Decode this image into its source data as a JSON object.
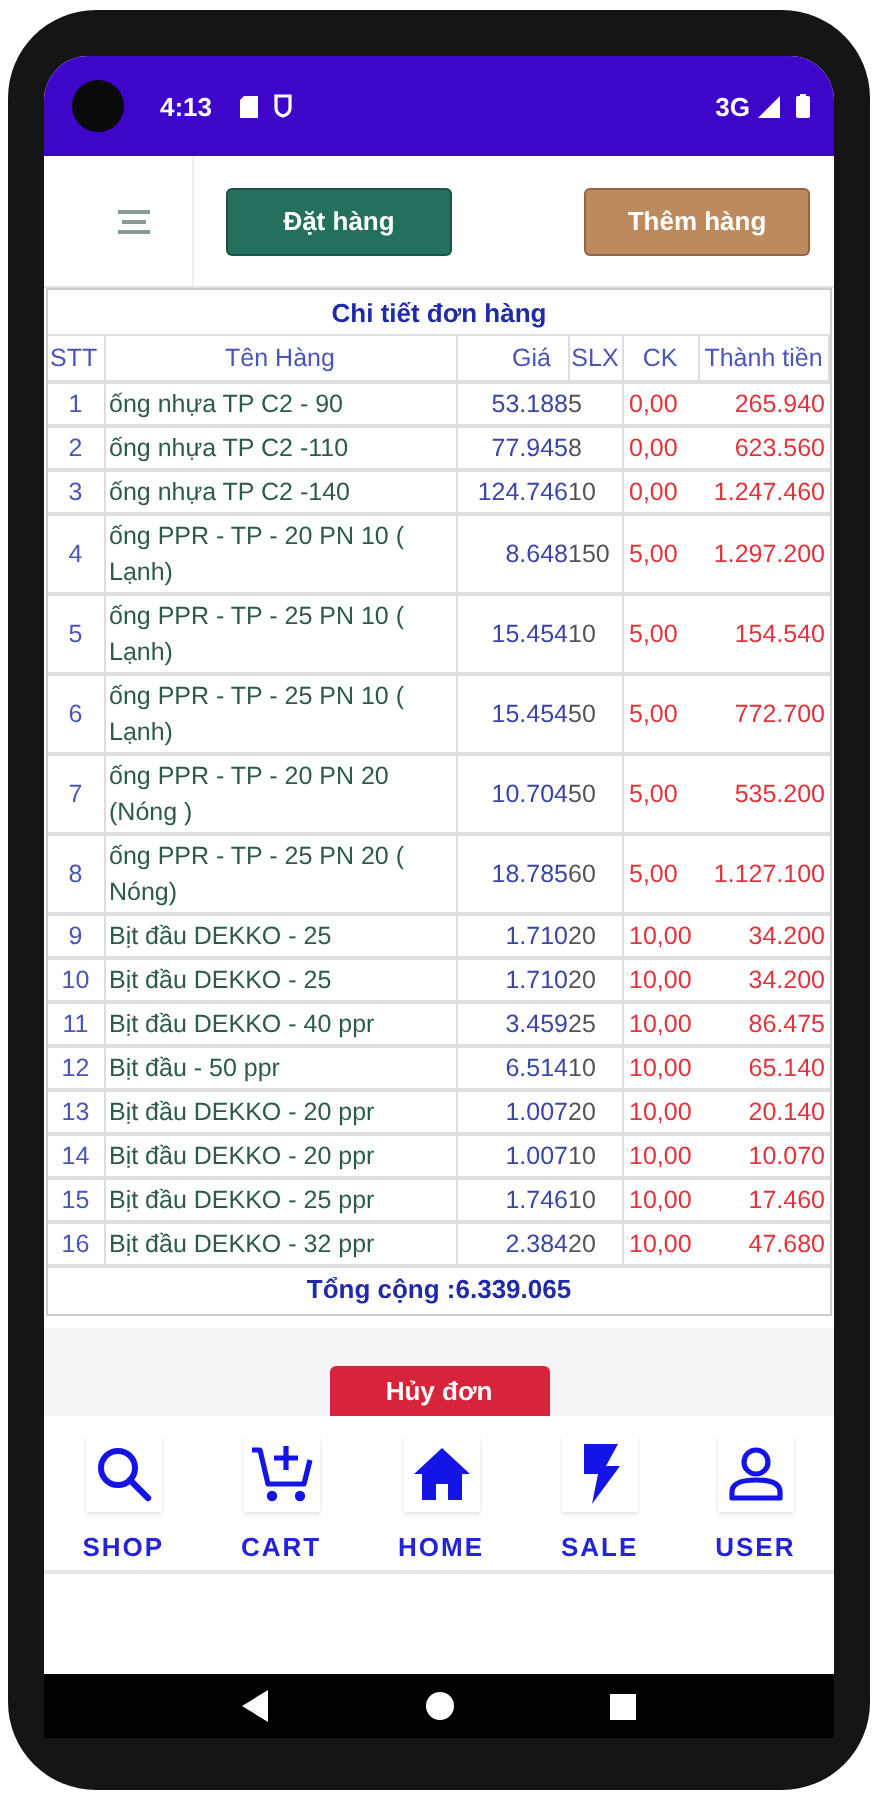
{
  "status_bar": {
    "time": "4:13",
    "network": "3G"
  },
  "toolbar": {
    "buttons": [
      {
        "label": "Đặt hàng",
        "kind": "primary"
      },
      {
        "label": "Thêm hàng",
        "kind": "secondary"
      }
    ]
  },
  "order_table": {
    "title": "Chi tiết đơn hàng",
    "columns": [
      "STT",
      "Tên Hàng",
      "Giá",
      "SLX",
      "CK",
      "Thành tiền"
    ],
    "rows": [
      {
        "stt": "1",
        "name": "ống nhựa TP C2 - 90",
        "price": "53.188",
        "qty": "5",
        "discount": "0,00",
        "total": "265.940"
      },
      {
        "stt": "2",
        "name": "ống nhựa TP C2 -110",
        "price": "77.945",
        "qty": "8",
        "discount": "0,00",
        "total": "623.560"
      },
      {
        "stt": "3",
        "name": "ống nhựa TP C2 -140",
        "price": "124.746",
        "qty": "10",
        "discount": "0,00",
        "total": "1.247.460"
      },
      {
        "stt": "4",
        "name": "ống PPR - TP - 20 PN 10 ( Lạnh)",
        "price": "8.648",
        "qty": "150",
        "discount": "5,00",
        "total": "1.297.200"
      },
      {
        "stt": "5",
        "name": "ống PPR - TP - 25 PN 10 ( Lạnh)",
        "price": "15.454",
        "qty": "10",
        "discount": "5,00",
        "total": "154.540"
      },
      {
        "stt": "6",
        "name": "ống PPR - TP - 25 PN 10 ( Lạnh)",
        "price": "15.454",
        "qty": "50",
        "discount": "5,00",
        "total": "772.700"
      },
      {
        "stt": "7",
        "name": "ống PPR - TP - 20 PN 20 (Nóng )",
        "price": "10.704",
        "qty": "50",
        "discount": "5,00",
        "total": "535.200"
      },
      {
        "stt": "8",
        "name": "ống PPR - TP - 25 PN 20 ( Nóng)",
        "price": "18.785",
        "qty": "60",
        "discount": "5,00",
        "total": "1.127.100"
      },
      {
        "stt": "9",
        "name": "Bịt đầu DEKKO - 25",
        "price": "1.710",
        "qty": "20",
        "discount": "10,00",
        "total": "34.200"
      },
      {
        "stt": "10",
        "name": "Bịt đầu DEKKO - 25",
        "price": "1.710",
        "qty": "20",
        "discount": "10,00",
        "total": "34.200"
      },
      {
        "stt": "11",
        "name": "Bịt đầu DEKKO - 40 ppr",
        "price": "3.459",
        "qty": "25",
        "discount": "10,00",
        "total": "86.475"
      },
      {
        "stt": "12",
        "name": "Bịt đầu - 50 ppr",
        "price": "6.514",
        "qty": "10",
        "discount": "10,00",
        "total": "65.140"
      },
      {
        "stt": "13",
        "name": "Bịt đầu DEKKO - 20 ppr",
        "price": "1.007",
        "qty": "20",
        "discount": "10,00",
        "total": "20.140"
      },
      {
        "stt": "14",
        "name": "Bịt đầu DEKKO - 20 ppr",
        "price": "1.007",
        "qty": "10",
        "discount": "10,00",
        "total": "10.070"
      },
      {
        "stt": "15",
        "name": "Bịt đầu DEKKO - 25 ppr",
        "price": "1.746",
        "qty": "10",
        "discount": "10,00",
        "total": "17.460"
      },
      {
        "stt": "16",
        "name": "Bịt đầu DEKKO - 32 ppr",
        "price": "2.384",
        "qty": "20",
        "discount": "10,00",
        "total": "47.680"
      }
    ],
    "total": "Tổng cộng :6.339.065"
  },
  "cancel_button": "Hủy đơn",
  "bottom_nav": [
    {
      "label": "SHOP",
      "kind": "search"
    },
    {
      "label": "CART",
      "kind": "cart"
    },
    {
      "label": "HOME",
      "kind": "home"
    },
    {
      "label": "SALE",
      "kind": "bolt"
    },
    {
      "label": "USER",
      "kind": "user"
    }
  ]
}
